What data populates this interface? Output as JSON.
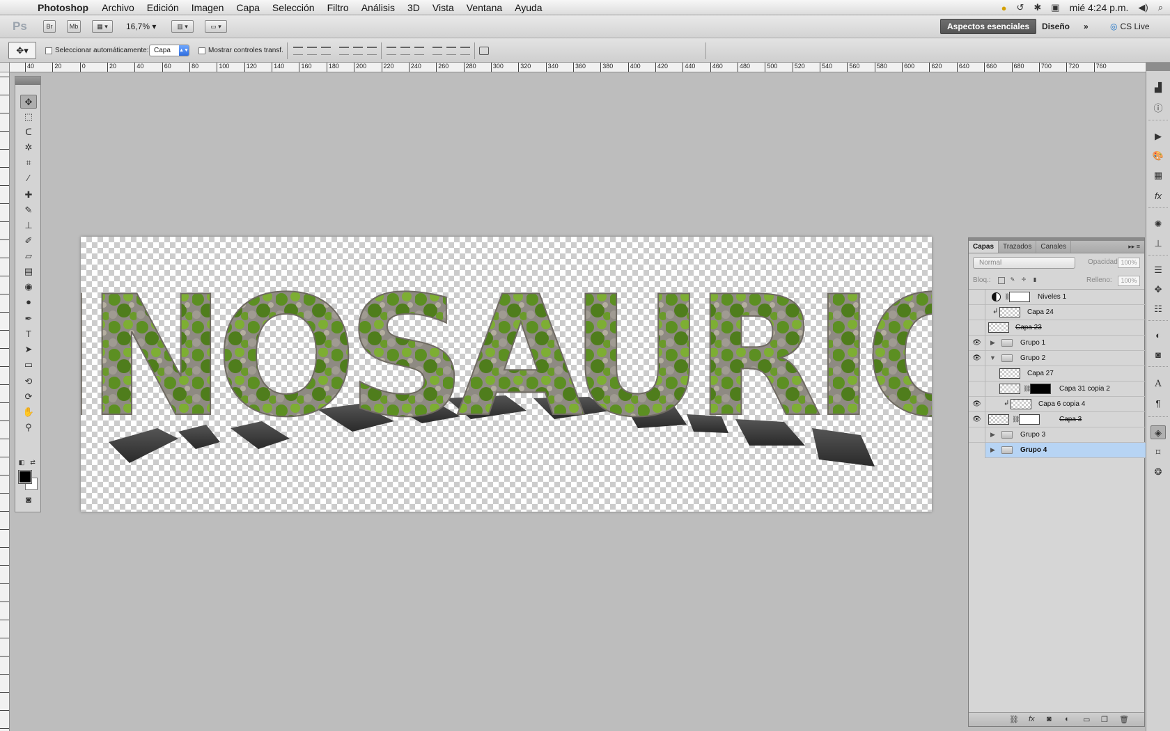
{
  "menubar": {
    "app_name": "Photoshop",
    "items": [
      "Archivo",
      "Edición",
      "Imagen",
      "Capa",
      "Selección",
      "Filtro",
      "Análisis",
      "3D",
      "Vista",
      "Ventana",
      "Ayuda"
    ],
    "clock": "mié 4:24 p.m."
  },
  "appbar": {
    "logo": "Ps",
    "bridge": "Br",
    "minibridge": "Mb",
    "zoom": "16,7%",
    "workspace_active": "Aspectos esenciales",
    "workspace_design": "Diseño",
    "more": "»",
    "cs_live": "CS Live"
  },
  "options": {
    "auto_select_label": "Seleccionar automáticamente:",
    "auto_select_value": "Capa",
    "show_transform_label": "Mostrar controles transf."
  },
  "rulers": {
    "top_labels": [
      "40",
      "20",
      "0",
      "20",
      "40",
      "60",
      "80",
      "100",
      "120",
      "140",
      "160",
      "180",
      "200",
      "220",
      "240",
      "260",
      "280",
      "300",
      "320",
      "340",
      "360",
      "380",
      "400",
      "420",
      "440",
      "460",
      "480",
      "500",
      "520",
      "540",
      "560",
      "580",
      "600",
      "620",
      "640",
      "660",
      "680",
      "700",
      "720",
      "760"
    ]
  },
  "artwork": {
    "title_text": "DINOSAURIOS",
    "colors": {
      "moss": "#5a8a2a",
      "stone": "#9a948c",
      "shadow": "#3a3a3a"
    }
  },
  "layers_panel": {
    "tabs": [
      "Capas",
      "Trazados",
      "Canales"
    ],
    "blend_mode": "Normal",
    "opacity_label": "Opacidad:",
    "opacity_value": "100%",
    "lock_label": "Bloq.:",
    "fill_label": "Relleno:",
    "fill_value": "100%",
    "layers": [
      {
        "name": "Niveles 1",
        "visible": false,
        "type": "adjustment"
      },
      {
        "name": "Capa 24",
        "visible": false,
        "type": "clipped"
      },
      {
        "name": "Capa 23",
        "visible": false,
        "type": "layer"
      },
      {
        "name": "Grupo 1",
        "visible": true,
        "type": "group-collapsed"
      },
      {
        "name": "Grupo 2",
        "visible": true,
        "type": "group-expanded"
      },
      {
        "name": "Capa 27",
        "visible": false,
        "type": "child"
      },
      {
        "name": "Capa 31 copia 2",
        "visible": false,
        "type": "child-masked"
      },
      {
        "name": "Capa 6 copia 4",
        "visible": true,
        "type": "child-clipped"
      },
      {
        "name": "Capa 3",
        "visible": true,
        "type": "child-masked-white"
      },
      {
        "name": "Grupo 3",
        "visible": false,
        "type": "group-collapsed"
      },
      {
        "name": "Grupo 4",
        "visible": false,
        "type": "group-collapsed",
        "selected": true
      }
    ]
  }
}
